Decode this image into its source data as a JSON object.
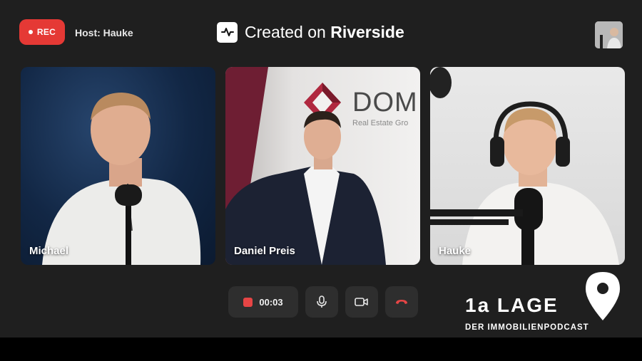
{
  "header": {
    "rec_label": "REC",
    "host_label": "Host: Hauke",
    "brand_prefix": "Created on ",
    "brand_name": "Riverside"
  },
  "participants": [
    {
      "name": "Michael"
    },
    {
      "name": "Daniel Preis"
    },
    {
      "name": "Hauke"
    }
  ],
  "backdrop": {
    "logo_text": "DOM",
    "logo_subtext": "Real Estate Gro"
  },
  "controls": {
    "timer": "00:03",
    "mic_icon": "microphone-icon",
    "camera_icon": "camera-icon",
    "hangup_icon": "hang-up-icon"
  },
  "podcast": {
    "title": "1a LAGE",
    "subtitle": "DER IMMOBILIENPODCAST",
    "icon": "location-pin-icon"
  },
  "colors": {
    "record_red": "#e53935",
    "stage_bg": "#1f1f1f",
    "control_bg": "#2e2e2e",
    "hangup_red": "#e64545",
    "dom_red": "#b0283f"
  }
}
